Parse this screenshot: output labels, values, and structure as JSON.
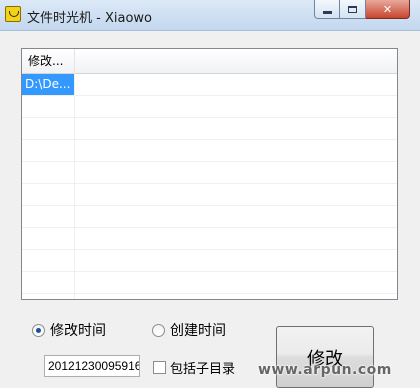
{
  "window": {
    "title": "文件时光机 - Xiaowo",
    "icon": "app-icon",
    "controls": {
      "minimize": "minimize-icon",
      "maximize": "maximize-icon",
      "close": "✕"
    }
  },
  "file_list": {
    "columns": [
      "修改..."
    ],
    "rows": [
      {
        "path": "D:\\De...",
        "selected": true
      }
    ]
  },
  "time_mode": {
    "options": [
      {
        "label": "修改时间",
        "checked": true
      },
      {
        "label": "创建时间",
        "checked": false
      }
    ]
  },
  "datetime_value": "20121230095916",
  "include_subdirs": {
    "label": "包括子目录",
    "checked": false
  },
  "modify_button": {
    "label": "修改"
  },
  "watermark": {
    "text": "www.arpun.com"
  },
  "colors": {
    "selection": "#3399ff",
    "titlebar": "#c3d7ee",
    "close": "#c7452f"
  }
}
